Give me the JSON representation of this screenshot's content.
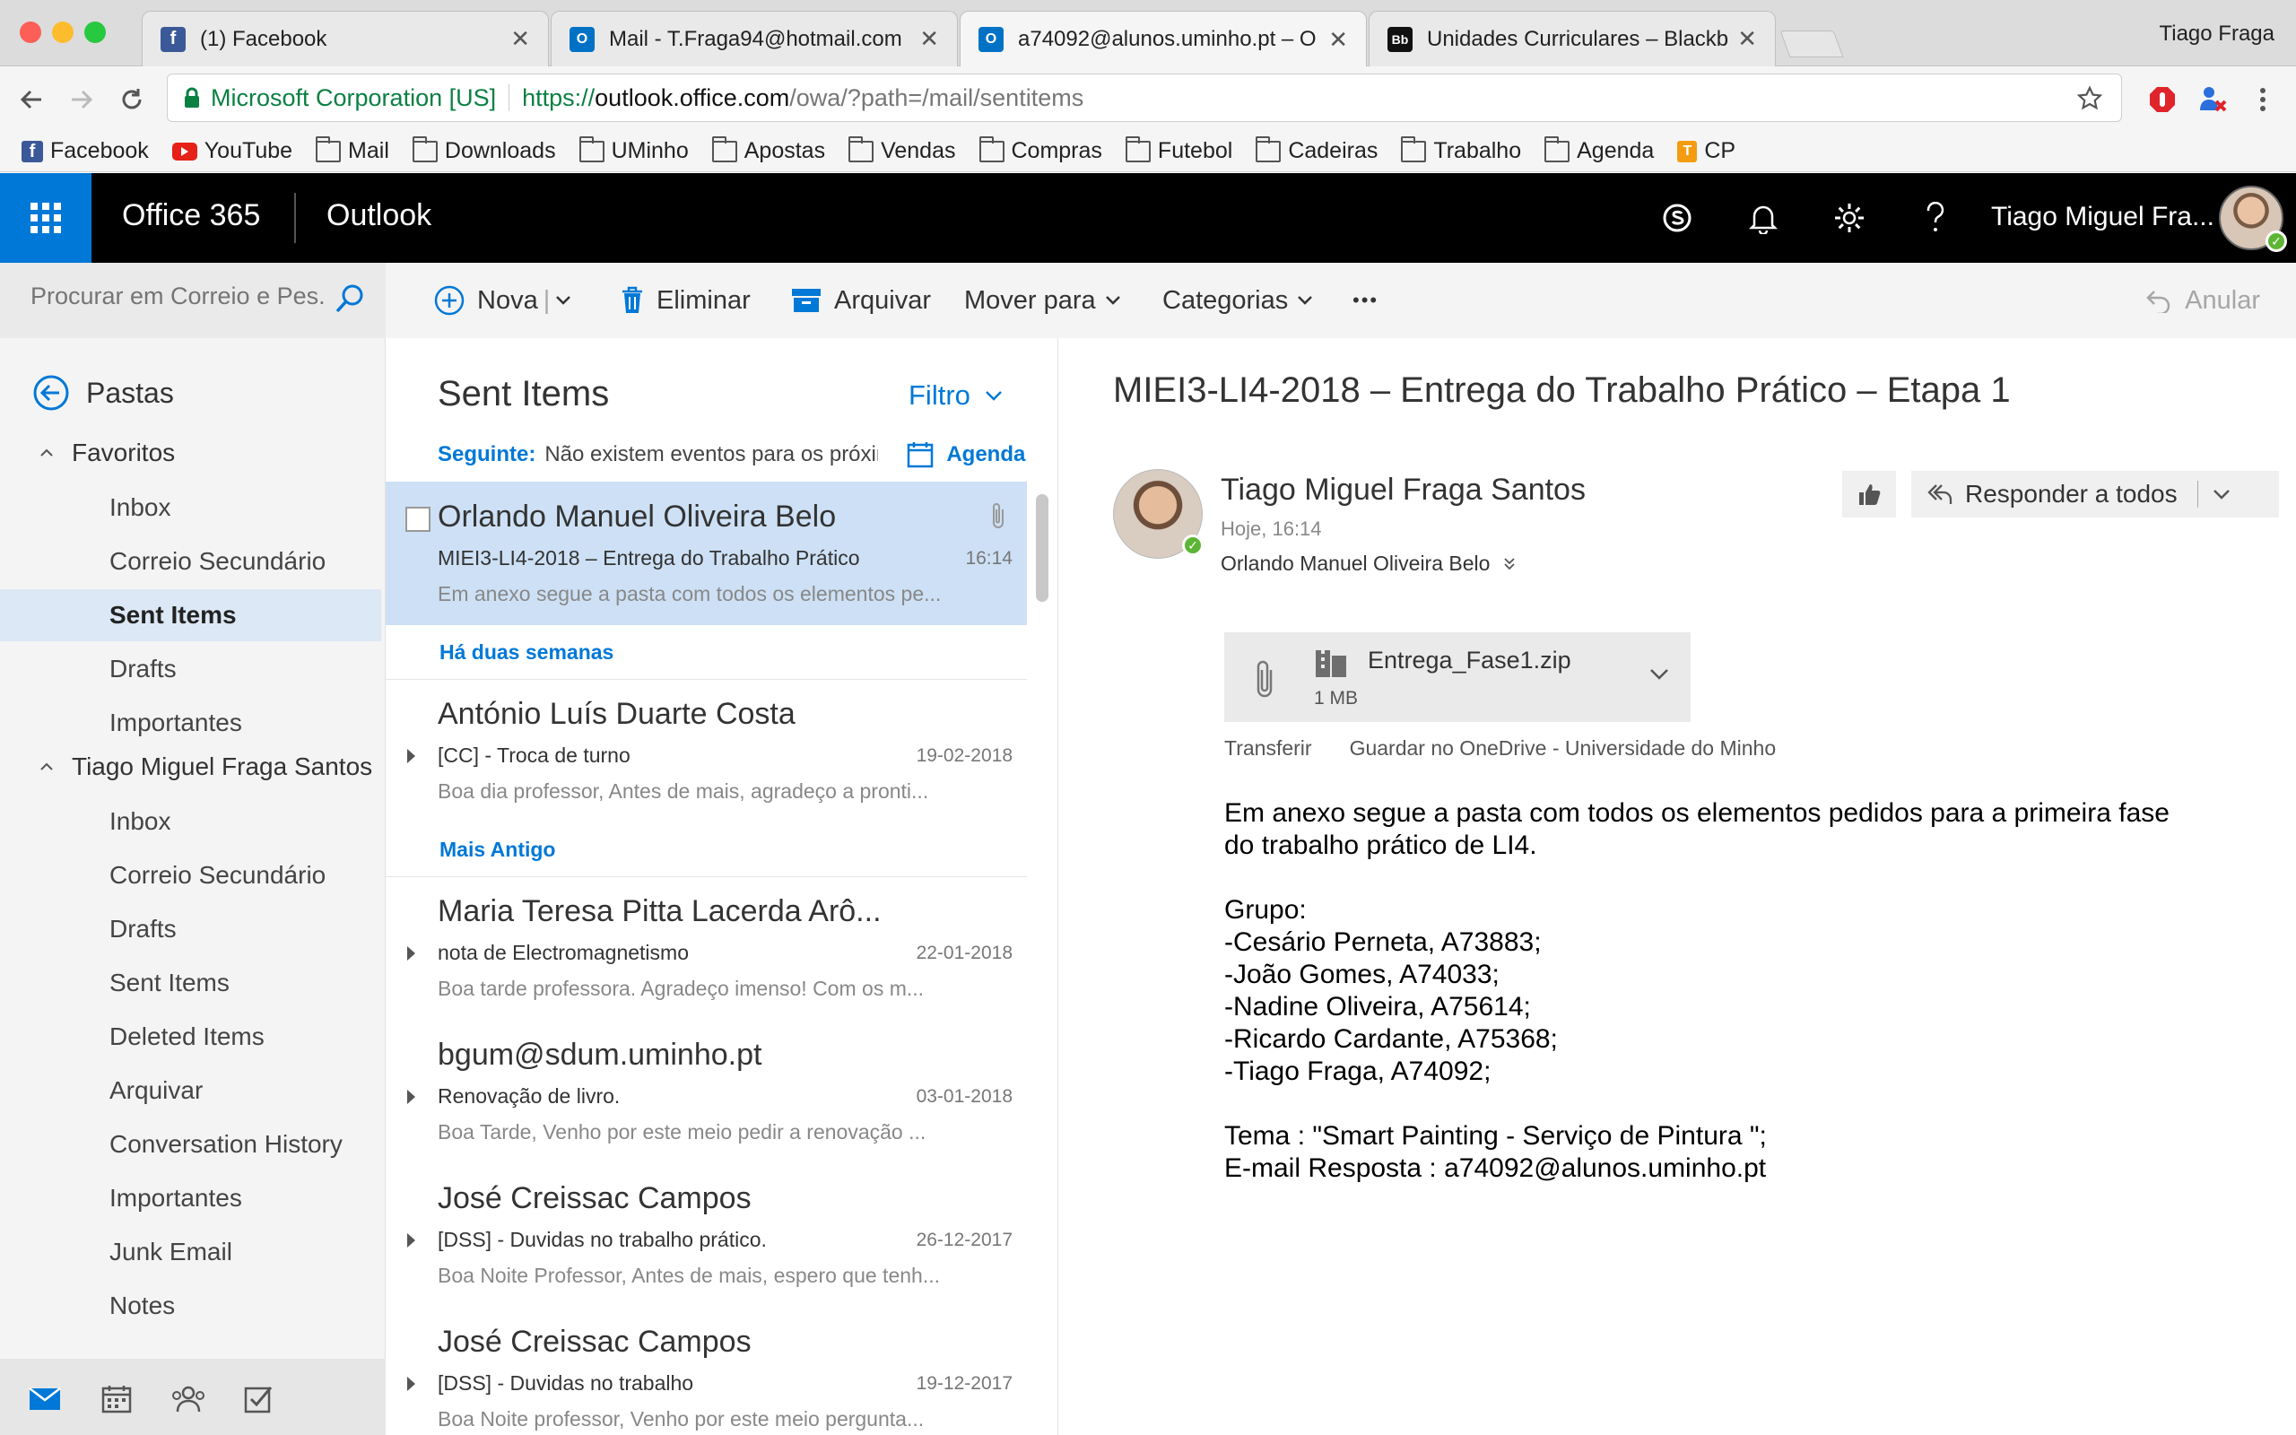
{
  "browser": {
    "tabs": [
      {
        "title": "(1) Facebook",
        "icon": "facebook-icon"
      },
      {
        "title": "Mail - T.Fraga94@hotmail.com",
        "icon": "outlook-icon"
      },
      {
        "title": "a74092@alunos.uminho.pt – O",
        "icon": "outlook-icon"
      },
      {
        "title": "Unidades Curriculares – Blackb",
        "icon": "blackboard-icon"
      }
    ],
    "profile_name": "Tiago Fraga",
    "secure_label": "Microsoft Corporation [US]",
    "url_scheme": "https://",
    "url_host": "outlook.office.com",
    "url_path": "/owa/?path=/mail/sentitems",
    "bookmarks": [
      {
        "label": "Facebook",
        "icon": "facebook-icon"
      },
      {
        "label": "YouTube",
        "icon": "youtube-icon"
      },
      {
        "label": "Mail",
        "icon": "folder-icon"
      },
      {
        "label": "Downloads",
        "icon": "folder-icon"
      },
      {
        "label": "UMinho",
        "icon": "folder-icon"
      },
      {
        "label": "Apostas",
        "icon": "folder-icon"
      },
      {
        "label": "Vendas",
        "icon": "folder-icon"
      },
      {
        "label": "Compras",
        "icon": "folder-icon"
      },
      {
        "label": "Futebol",
        "icon": "folder-icon"
      },
      {
        "label": "Cadeiras",
        "icon": "folder-icon"
      },
      {
        "label": "Trabalho",
        "icon": "folder-icon"
      },
      {
        "label": "Agenda",
        "icon": "folder-icon"
      },
      {
        "label": "CP",
        "icon": "cp-icon"
      }
    ]
  },
  "header": {
    "brand": "Office 365",
    "app": "Outlook",
    "user_name": "Tiago Miguel Fra..."
  },
  "toolbar": {
    "search_placeholder": "Procurar em Correio e Pes...",
    "new_label": "Nova",
    "delete_label": "Eliminar",
    "archive_label": "Arquivar",
    "move_label": "Mover para",
    "categories_label": "Categorias",
    "more_label": "•••",
    "undo_label": "Anular"
  },
  "folders": {
    "back_label": "Pastas",
    "groups": [
      {
        "label": "Favoritos",
        "items": [
          "Inbox",
          "Correio Secundário",
          "Sent Items",
          "Drafts",
          "Importantes"
        ]
      },
      {
        "label": "Tiago Miguel Fraga Santos",
        "items": [
          "Inbox",
          "Correio Secundário",
          "Drafts",
          "Sent Items",
          "Deleted Items",
          "Arquivar",
          "Conversation History",
          "Importantes",
          "Junk Email",
          "Notes"
        ]
      }
    ],
    "selected": "Sent Items"
  },
  "list": {
    "title": "Sent Items",
    "filter_label": "Filtro",
    "next_label": "Seguinte:",
    "next_text": "Não existem eventos para os próximos",
    "agenda_label": "Agenda",
    "group_headers": [
      "Há duas semanas",
      "Mais Antigo"
    ],
    "messages": [
      {
        "from": "Orlando Manuel Oliveira Belo",
        "subject": "MIEI3-LI4-2018 – Entrega do Trabalho Prático",
        "date": "16:14",
        "preview": "Em anexo segue a pasta com todos os elementos pe..."
      },
      {
        "from": "António Luís Duarte Costa",
        "subject": "[CC] - Troca de turno",
        "date": "19-02-2018",
        "preview": "Boa dia professor,    Antes de mais, agradeço a pronti..."
      },
      {
        "from": "Maria Teresa Pitta Lacerda Arô...",
        "subject": "nota de Electromagnetismo",
        "date": "22-01-2018",
        "preview": "Boa tarde professora.  Agradeço imenso!  Com os m..."
      },
      {
        "from": "bgum@sdum.uminho.pt",
        "subject": "Renovação de livro.",
        "date": "03-01-2018",
        "preview": "Boa Tarde,    Venho por este meio pedir a renovação ..."
      },
      {
        "from": "José Creissac Campos",
        "subject": "[DSS] - Duvidas no trabalho prático.",
        "date": "26-12-2017",
        "preview": "Boa Noite Professor,  Antes de mais, espero que tenh..."
      },
      {
        "from": "José Creissac Campos",
        "subject": "[DSS] - Duvidas no trabalho",
        "date": "19-12-2017",
        "preview": "Boa Noite professor,    Venho por este meio pergunta..."
      }
    ]
  },
  "reading": {
    "subject": "MIEI3-LI4-2018 – Entrega do Trabalho Prático – Etapa 1",
    "sender": "Tiago Miguel Fraga Santos",
    "time": "Hoje, 16:14",
    "to": "Orlando Manuel Oliveira Belo",
    "reply_all_label": "Responder a todos",
    "attachment": {
      "name": "Entrega_Fase1.zip",
      "size": "1 MB"
    },
    "attachment_actions": [
      "Transferir",
      "Guardar no OneDrive - Universidade do Minho"
    ],
    "body_lines": [
      "Em anexo segue a pasta com todos os elementos pedidos para a primeira fase",
      "do trabalho prático de LI4.",
      "",
      "Grupo:",
      "-Cesário Perneta, A73883;",
      "-João Gomes, A74033;",
      "-Nadine Oliveira, A75614;",
      "-Ricardo Cardante, A75368;",
      "-Tiago Fraga, A74092;",
      "",
      "Tema : \"Smart Painting - Serviço de Pintura \";",
      "E-mail Resposta : a74092@alunos.uminho.pt"
    ]
  },
  "colors": {
    "accent": "#0078d7",
    "header_bg": "#000000",
    "selected_folder_bg": "#dce8f5",
    "selected_message_bg": "#cde0f5",
    "secure_green": "#0b8043",
    "presence_green": "#5db535"
  }
}
